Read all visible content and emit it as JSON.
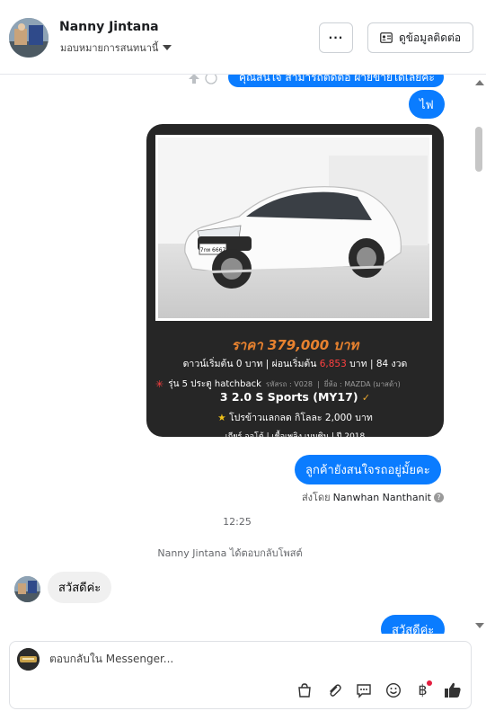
{
  "header": {
    "contact_name": "Nanny Jintana",
    "assign_label": "มอบหมายการสนทนานี้",
    "more_label": "···",
    "contact_info_label": "ดูข้อมูลติดต่อ"
  },
  "messages": {
    "cut_off_text": "คุณสนใจ สามารถติดต่อ ฝ่ายขายได้เลยค่ะ",
    "fire_text": "ไฟ",
    "question_text": "ลูกค้ายังสนใจรถอยู่มั้ยคะ",
    "sent_by_prefix": "ส่งโดย",
    "sent_by_name": "Nanwhan Nanthanit",
    "time": "12:25",
    "notice": "Nanny Jintana ได้ตอบกลับโพสต์",
    "greeting_in": "สวัสดีค่ะ",
    "greeting_out": "สวัสดีค่ะ"
  },
  "card": {
    "plate": "7กท 6667",
    "price": "ราคา 379,000 บาท",
    "down_prefix": "ดาวน์เริ่มต้น 0 บาท | ผ่อนเริ่มต้น",
    "installment": "6,853",
    "down_suffix": "บาท | 84 งวด",
    "model": "รุ่น 5 ประตู hatchback",
    "stock_code": "รหัสรถ : V028",
    "brand": "ยี่ห้อ : MAZDA (มาสด้า)",
    "variant": "3 2.0 S Sports (MY17)",
    "promo": "โปรข้าวแลกลด กิโลละ 2,000 บาท",
    "specs": "เกียร์ ออโต้  |  เชื้อเพลิง เบนซิน  |  ปี 2018"
  },
  "composer": {
    "placeholder": "ตอบกลับใน Messenger..."
  },
  "colors": {
    "accent": "#0a7cff",
    "price_orange": "#e8822f",
    "card_bg": "#262626"
  }
}
